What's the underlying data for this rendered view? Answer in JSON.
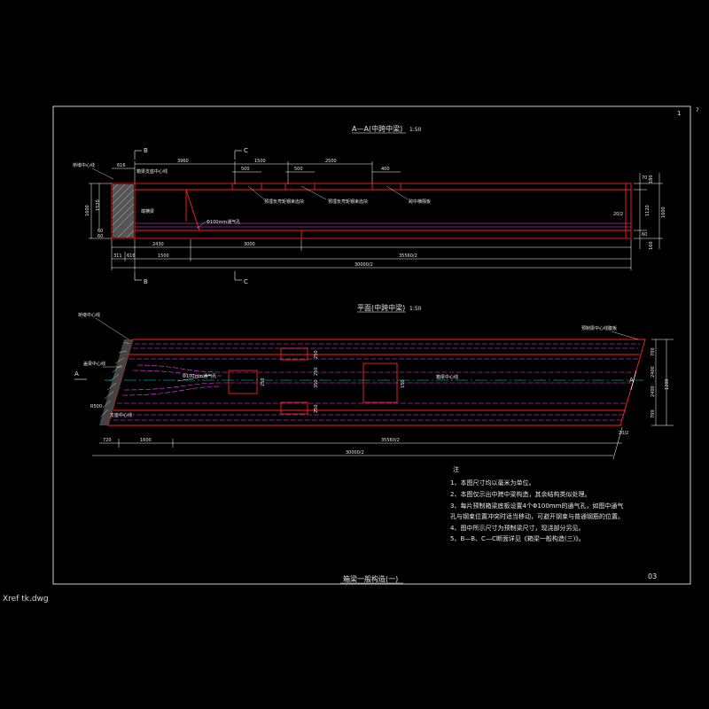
{
  "sheet": {
    "page_number": "1",
    "page_mark": "7",
    "sheet_code": "03",
    "drawing_title": "箱梁一般构造(一)",
    "xref_label": "Xref tk.dwg"
  },
  "elevation": {
    "title": "A—A(中跨中梁)",
    "scale": "1:50",
    "section_b": "B",
    "section_c": "C",
    "top_dims": [
      "616",
      "3960",
      "1500",
      "2500",
      "500",
      "500",
      "400"
    ],
    "bottom_dims": [
      "311",
      "616",
      "1500",
      "2430",
      "3000",
      "35560/2",
      "30000/2"
    ],
    "right_dims": [
      "70",
      "180",
      "1120",
      "1600",
      "60",
      "160"
    ],
    "left_dims": [
      "1600",
      "1520",
      "60",
      "60"
    ],
    "labels": {
      "bearing_line": "桥墩中心线",
      "support_center": "箱梁支座中心线",
      "inner_dia": "端横梁",
      "vent": "Φ100mm通气孔",
      "neg_moment_1": "预埋负弯矩钢束齿块",
      "neg_moment_2": "预埋负弯矩钢束齿块",
      "span_beam": "跨中横隔板",
      "half_span": "20/2"
    }
  },
  "plan": {
    "title": "平面(中跨中梁)",
    "scale": "1:50",
    "section_a": "A",
    "right_dims": [
      "700",
      "2400",
      "2400",
      "700",
      "1200"
    ],
    "bottom_dims": [
      "720",
      "1600",
      "35560/2",
      "30000/2",
      "20/2"
    ],
    "inner_dims": [
      "250",
      "250",
      "250",
      "350",
      "250",
      "150"
    ],
    "labels": {
      "bearing_line": "桥墩中心线",
      "pier_center": "盖梁中心线",
      "cap_center": "盖梁中心线",
      "support_center": "支座中心线",
      "vent": "Φ100mm通气孔",
      "beam_axis": "箱梁中心线",
      "top_right": "预制梁中心线腹板",
      "r500": "R500"
    }
  },
  "notes": {
    "heading": "注",
    "items": [
      "1、本图尺寸均以毫米为单位。",
      "2、本图仅示出中跨中梁构造，其余结构类似处理。",
      "3、每片预制箱梁底板设置4个Φ100mm的通气孔，如图中通气",
      "   孔与钢束位置冲突时适当移动，可避开钢束与普通钢筋的位置。",
      "4、图中所示尺寸为预制梁尺寸，现浇部分另见。",
      "5、B—B、C—C断面详见《箱梁一般构造(三)》。"
    ]
  },
  "colors": {
    "frame": "#ffffff",
    "beam_outline": "#ff2020",
    "tendon": "#ff40ff",
    "dimension": "#ffffff",
    "centerline": "#00e0e0",
    "hatch": "#d0d0d0"
  }
}
